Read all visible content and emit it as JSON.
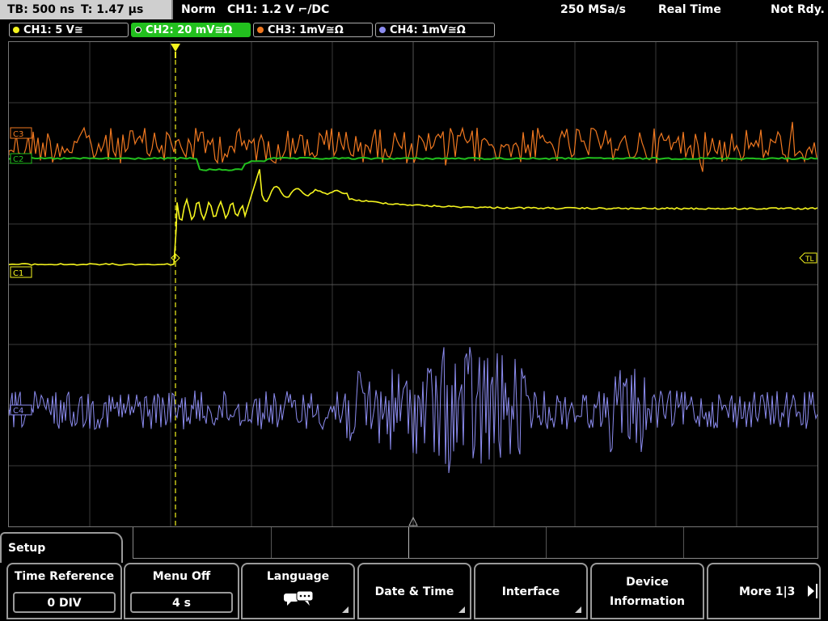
{
  "status_bar": {
    "timebase": "TB: 500 ns",
    "trigger_time": "T: 1.47 µs",
    "mode": "Norm",
    "trigger_info": "CH1: 1.2 V ⌐/DC",
    "sample_rate": "250 MSa/s",
    "acq_mode": "Real Time",
    "state": "Not Rdy."
  },
  "channels": [
    {
      "label": "CH1: 5 V≅",
      "color": "#f5f51e",
      "active": false
    },
    {
      "label": "CH2: 20 mV≅Ω",
      "color": "#22c01e",
      "active": true
    },
    {
      "label": "CH3: 1mV≅Ω",
      "color": "#f07820",
      "active": false
    },
    {
      "label": "CH4: 1mV≅Ω",
      "color": "#8c8cf0",
      "active": false
    }
  ],
  "markers": {
    "ch3": "C3",
    "ch2": "C2",
    "ch1": "C1",
    "ch4": "C4",
    "trigger_level": "TL"
  },
  "colors": {
    "ch1": "#f5f51e",
    "ch2": "#22c01e",
    "ch3": "#f07820",
    "ch4": "#8c8cf0",
    "grid": "#3a3a3a",
    "trigger": "#f5f51e"
  },
  "menu": {
    "title": "Setup",
    "softkeys": [
      {
        "label": "Time Reference",
        "value": "0 DIV"
      },
      {
        "label": "Menu Off",
        "value": "4 s"
      },
      {
        "label": "Language",
        "icon": "speech-bubbles-icon"
      },
      {
        "label": "Date & Time"
      },
      {
        "label": "Interface"
      },
      {
        "label": "Device",
        "label2": "Information"
      },
      {
        "label": "More 1|3"
      }
    ]
  },
  "chart_data": {
    "type": "line",
    "grid": {
      "h_div": 10,
      "v_div": 8
    },
    "series": [
      {
        "name": "CH1",
        "color": "#f5f51e"
      },
      {
        "name": "CH2",
        "color": "#22c01e"
      },
      {
        "name": "CH3",
        "color": "#f07820"
      },
      {
        "name": "CH4",
        "color": "#8c8cf0"
      }
    ]
  }
}
